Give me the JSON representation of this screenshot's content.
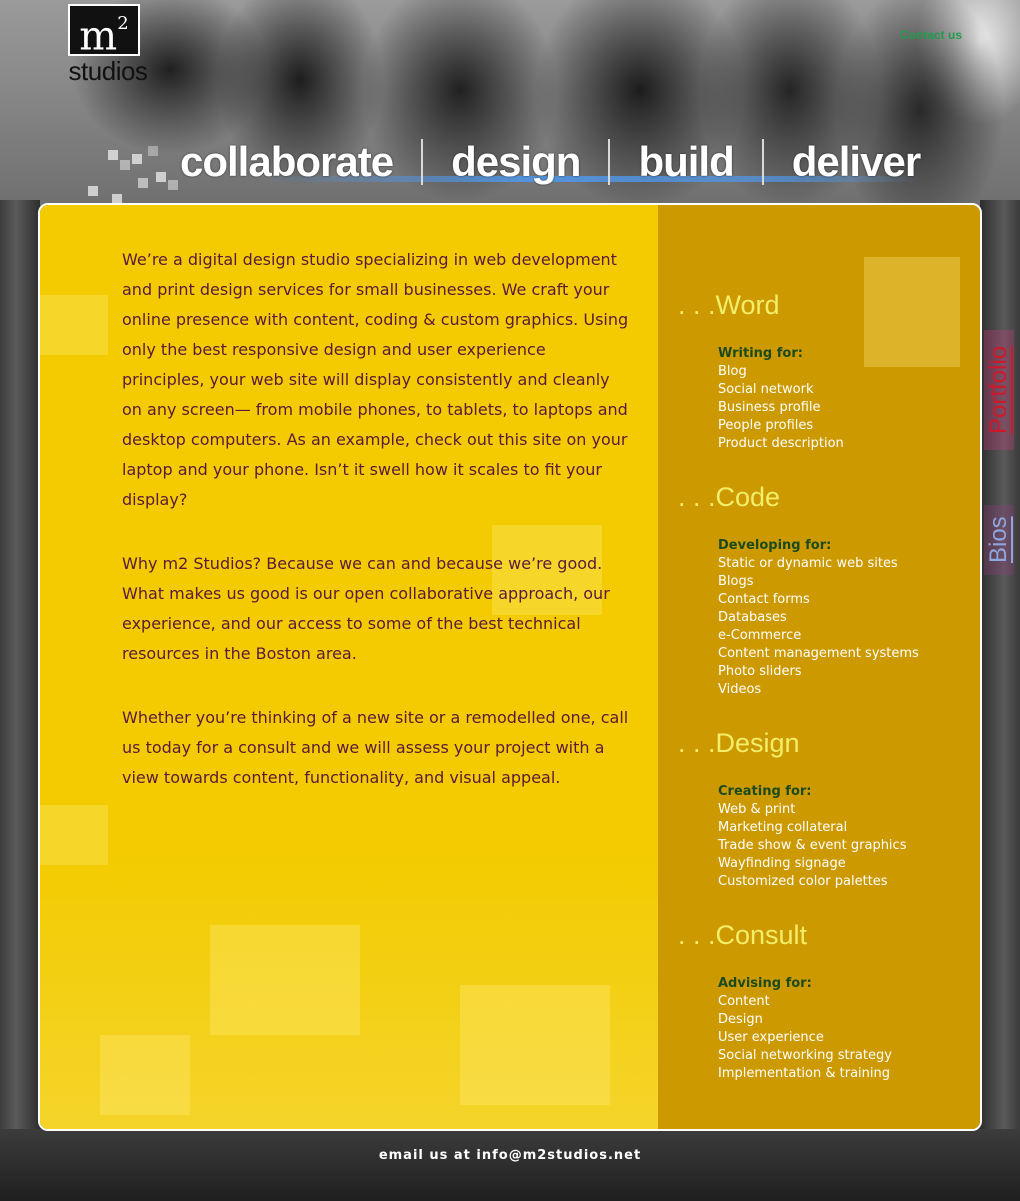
{
  "header": {
    "logo_mark": "m",
    "logo_sup": "2",
    "logo_word": "studios",
    "contact_link": "Contact us"
  },
  "tagline": [
    "collaborate",
    "design",
    "build",
    "deliver"
  ],
  "intro": {
    "paragraphs": [
      "We’re a digital design studio specializing in web development and print design services for small businesses. We craft your online presence with content, coding & custom graphics. Using only the best responsive design and user experience principles, your web site will display consistently and cleanly on any screen— from mobile phones, to tablets, to laptops and desktop computers. As an example, check out this site on your laptop and your phone. Isn’t it swell how it scales to fit your display?",
      "Why m2 Studios? Because we can and because we’re good. What makes us good is our open collaborative approach, our experience, and our access to some of the best technical resources in the Boston area.",
      "Whether you’re thinking of a new site or a remodelled one, call us today for a consult and we will assess your project with a view towards content, functionality, and visual appeal."
    ]
  },
  "services": [
    {
      "title": ". . .Word",
      "heading": "Writing for:",
      "items": [
        "Blog",
        "Social network",
        "Business profile",
        "People profiles",
        "Product description"
      ]
    },
    {
      "title": ". . .Code",
      "heading": "Developing for:",
      "items": [
        "Static or dynamic web sites",
        "Blogs",
        "Contact forms",
        "Databases",
        "e-Commerce",
        "Content management systems",
        "Photo sliders",
        "Videos"
      ]
    },
    {
      "title": ". . .Design",
      "heading": "Creating for:",
      "items": [
        "Web & print",
        "Marketing collateral",
        "Trade show & event graphics",
        "Wayfinding signage",
        "Customized color palettes"
      ]
    },
    {
      "title": ". . .Consult",
      "heading": "Advising for:",
      "items": [
        "Content",
        "Design",
        "User experience",
        "Social networking strategy",
        "Implementation & training"
      ]
    }
  ],
  "side_tabs": {
    "portfolio": "Portfolio",
    "bios": "Bios"
  },
  "footer": {
    "email_text": "email us at info@m2studios.net"
  },
  "colors": {
    "panel_left": "#f3cb00",
    "panel_right": "#cc9a00",
    "body_text": "#5a1a3a",
    "service_title": "#f2ee6a",
    "service_heading": "#1d4a1d",
    "contact_link": "#1f9d4d"
  }
}
